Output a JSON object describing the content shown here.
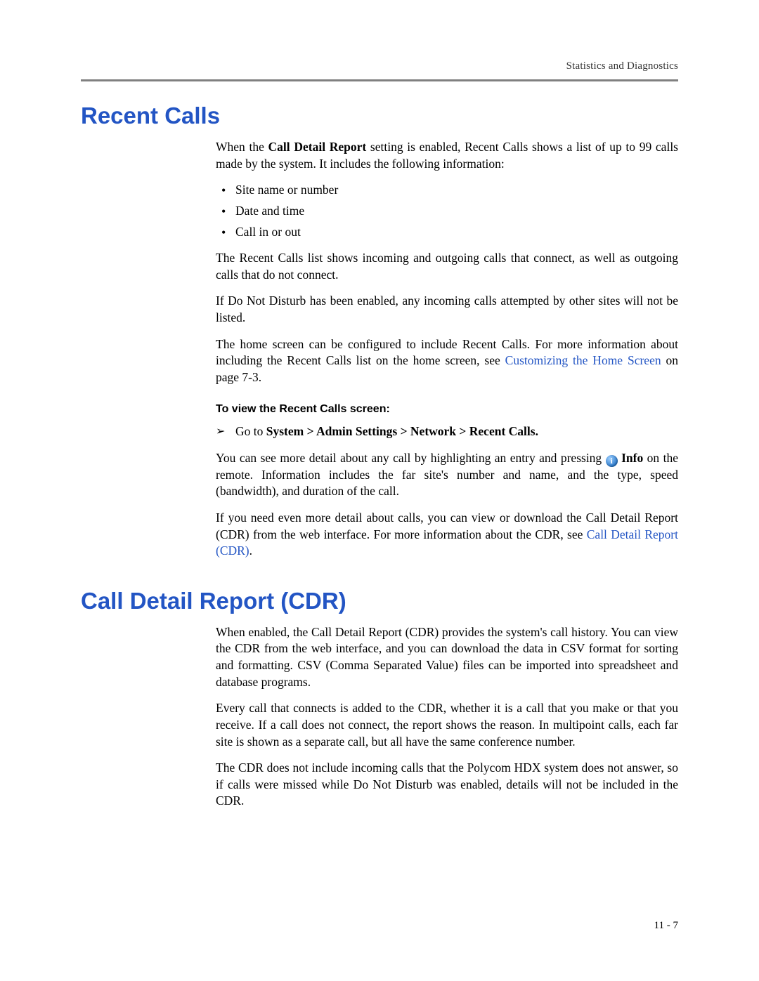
{
  "running_head": "Statistics and Diagnostics",
  "page_number": "11 - 7",
  "section1": {
    "title": "Recent Calls",
    "intro_a": "When the ",
    "intro_bold": "Call Detail Report",
    "intro_b": " setting is enabled, Recent Calls shows a list of up to 99 calls made by the system. It includes the following information:",
    "bullets": [
      "Site name or number",
      "Date and time",
      "Call in or out"
    ],
    "p1": "The Recent Calls list shows incoming and outgoing calls that connect, as well as outgoing calls that do not connect.",
    "p2": "If Do Not Disturb has been enabled, any incoming calls attempted by other sites will not be listed.",
    "p3_a": "The home screen can be configured to include Recent Calls. For more information about including the Recent Calls list on the home screen, see ",
    "p3_link": "Customizing the Home Screen",
    "p3_b": " on page 7-3.",
    "subhead": "To view the Recent Calls screen:",
    "step_a": "Go to ",
    "step_bold": "System > Admin Settings > Network > Recent Calls.",
    "p4_a": "You can see more detail about any call by highlighting an entry and pressing ",
    "p4_infoword": " Info",
    "p4_b": " on the remote. Information includes the far site's number and name, and the type, speed (bandwidth), and duration of the call.",
    "p5_a": "If you need even more detail about calls, you can view or download the Call Detail Report (CDR) from the web interface. For more information about the CDR, see ",
    "p5_link": "Call Detail Report (CDR)",
    "p5_b": "."
  },
  "section2": {
    "title": "Call Detail Report (CDR)",
    "p1": "When enabled, the Call Detail Report (CDR) provides the system's call history. You can view the CDR from the web interface, and you can download the data in CSV format for sorting and formatting. CSV (Comma Separated Value) files can be imported into spreadsheet and database programs.",
    "p2": "Every call that connects is added to the CDR, whether it is a call that you make or that you receive. If a call does not connect, the report shows the reason. In multipoint calls, each far site is shown as a separate call, but all have the same conference number.",
    "p3": "The CDR does not include incoming calls that the Polycom HDX system does not answer, so if calls were missed while Do Not Disturb was enabled, details will not be included in the CDR."
  }
}
